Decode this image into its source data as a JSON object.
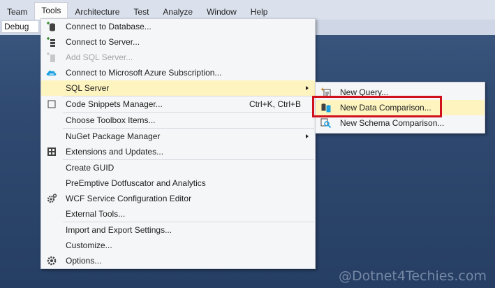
{
  "menubar": {
    "items": [
      "Team",
      "Tools",
      "Architecture",
      "Test",
      "Analyze",
      "Window",
      "Help"
    ],
    "active_index": 1
  },
  "toolbar": {
    "configuration": "Debug"
  },
  "tools_menu": {
    "items": [
      {
        "label": "Connect to Database...",
        "icon": "database-add-icon",
        "shortcut": "",
        "disabled": false
      },
      {
        "label": "Connect to Server...",
        "icon": "server-add-icon",
        "shortcut": "",
        "disabled": false
      },
      {
        "label": "Add SQL Server...",
        "icon": "sql-server-add-icon",
        "shortcut": "",
        "disabled": true
      },
      {
        "label": "Connect to Microsoft Azure Subscription...",
        "icon": "azure-cloud-icon",
        "shortcut": "",
        "disabled": false
      },
      {
        "label": "SQL Server",
        "icon": "",
        "shortcut": "",
        "disabled": false,
        "submenu": true
      },
      {
        "label": "Code Snippets Manager...",
        "icon": "snippet-icon",
        "shortcut": "Ctrl+K, Ctrl+B",
        "disabled": false
      },
      {
        "label": "Choose Toolbox Items...",
        "icon": "",
        "shortcut": "",
        "disabled": false
      },
      {
        "label": "NuGet Package Manager",
        "icon": "",
        "shortcut": "",
        "disabled": false,
        "submenu": true
      },
      {
        "label": "Extensions and Updates...",
        "icon": "extensions-icon",
        "shortcut": "",
        "disabled": false
      },
      {
        "label": "Create GUID",
        "icon": "",
        "shortcut": "",
        "disabled": false
      },
      {
        "label": "PreEmptive Dotfuscator and Analytics",
        "icon": "",
        "shortcut": "",
        "disabled": false
      },
      {
        "label": "WCF Service Configuration Editor",
        "icon": "wcf-gear-icon",
        "shortcut": "",
        "disabled": false
      },
      {
        "label": "External Tools...",
        "icon": "",
        "shortcut": "",
        "disabled": false
      },
      {
        "label": "Import and Export Settings...",
        "icon": "",
        "shortcut": "",
        "disabled": false
      },
      {
        "label": "Customize...",
        "icon": "",
        "shortcut": "",
        "disabled": false
      },
      {
        "label": "Options...",
        "icon": "gear-icon",
        "shortcut": "",
        "disabled": false
      }
    ]
  },
  "sql_submenu": {
    "items": [
      {
        "label": "New Query...",
        "icon": "new-query-icon"
      },
      {
        "label": "New Data Comparison...",
        "icon": "data-compare-icon"
      },
      {
        "label": "New Schema Comparison...",
        "icon": "schema-compare-icon"
      }
    ],
    "highlight_index": 1
  },
  "watermark": "@Dotnet4Techies.com",
  "colors": {
    "highlight": "#fdf4bf",
    "callout": "#d0101a",
    "menubar": "#dbe1ec",
    "background": "#2f4970"
  }
}
